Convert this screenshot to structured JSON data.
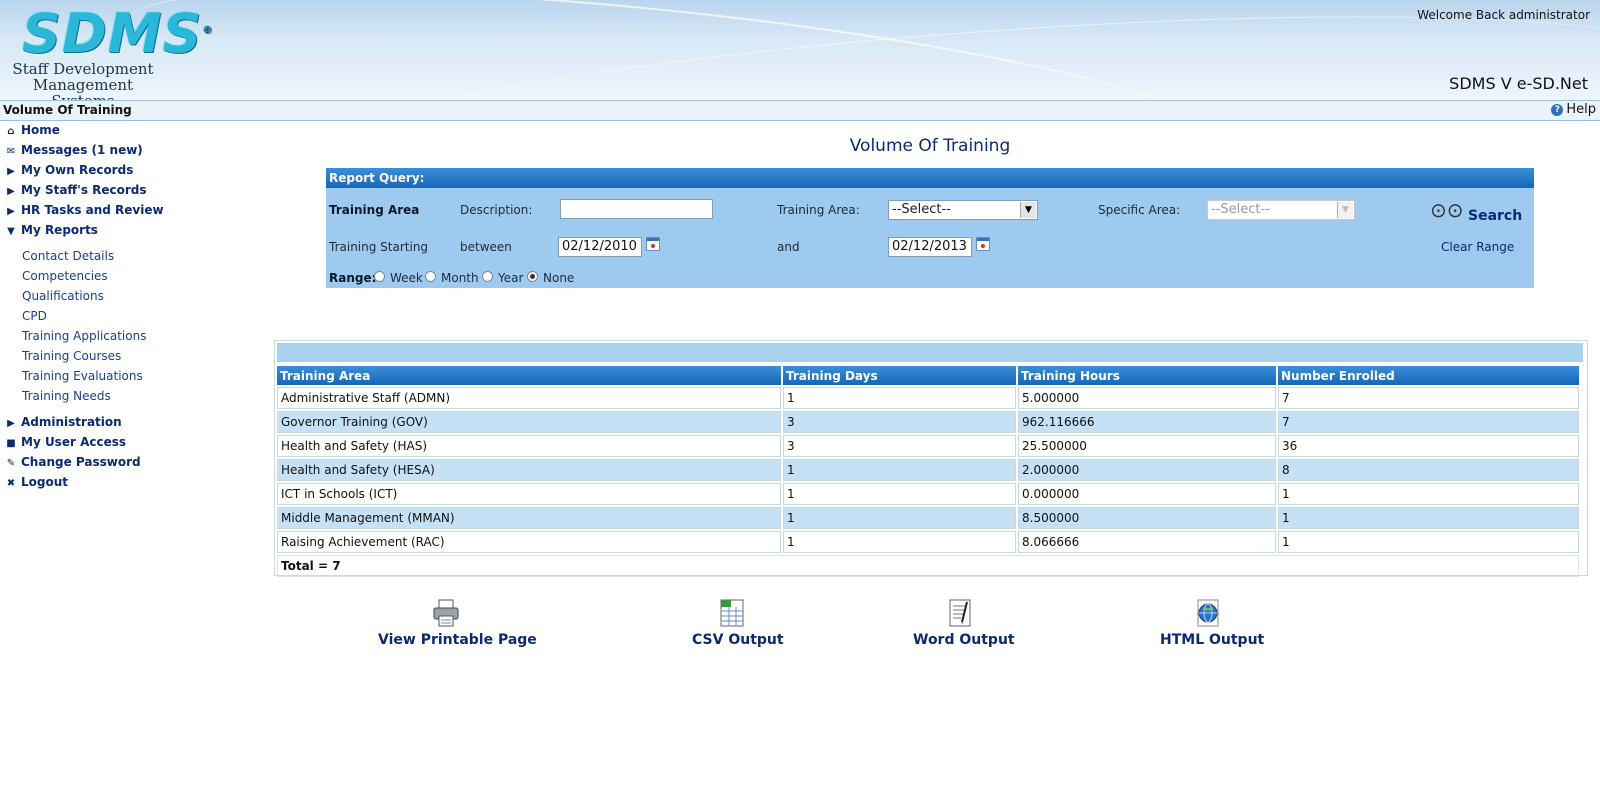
{
  "header": {
    "logo_text": "SDMS",
    "logo_subtitle_line1": "Staff Development",
    "logo_subtitle_line2": "Management Systems",
    "welcome": "Welcome Back administrator",
    "version": "SDMS V e-SD.Net"
  },
  "titlebar": {
    "title": "Volume Of Training",
    "help": "Help"
  },
  "sidebar": {
    "items": [
      {
        "label": "Home",
        "icon": "home-icon"
      },
      {
        "label": "Messages (1 new)",
        "icon": "envelope-icon"
      },
      {
        "label": "My Own Records",
        "icon": "triangle-right-icon"
      },
      {
        "label": "My Staff's Records",
        "icon": "triangle-right-icon"
      },
      {
        "label": "HR Tasks and Review",
        "icon": "triangle-right-icon"
      },
      {
        "label": "My Reports",
        "icon": "triangle-down-icon"
      }
    ],
    "subitems": [
      "Contact Details",
      "Competencies",
      "Qualifications",
      "CPD",
      "Training Applications",
      "Training Courses",
      "Training Evaluations",
      "Training Needs"
    ],
    "items_bottom": [
      {
        "label": "Administration",
        "icon": "triangle-right-icon"
      },
      {
        "label": "My User Access",
        "icon": "lock-icon"
      },
      {
        "label": "Change Password",
        "icon": "pen-icon"
      },
      {
        "label": "Logout",
        "icon": "x-icon"
      }
    ]
  },
  "main": {
    "page_title": "Volume Of Training",
    "query": {
      "header": "Report Query:",
      "training_area_label": "Training Area",
      "description_label": "Description:",
      "description_value": "",
      "area_label": "Training Area:",
      "area_value": "--Select--",
      "specific_label": "Specific Area:",
      "specific_value": "--Select--",
      "starting_label": "Training Starting",
      "between_label": "between",
      "from_date": "02/12/2010",
      "and_label": "and",
      "to_date": "02/12/2013",
      "range_label": "Range:",
      "range_options": [
        "Week",
        "Month",
        "Year",
        "None"
      ],
      "range_selected": "None",
      "search_label": "Search",
      "clear_label": "Clear Range"
    },
    "table": {
      "headers": [
        "Training Area",
        "Training Days",
        "Training Hours",
        "Number Enrolled"
      ],
      "rows": [
        [
          "Administrative Staff (ADMN)",
          "1",
          "5.000000",
          "7"
        ],
        [
          "Governor Training (GOV)",
          "3",
          "962.116666",
          "7"
        ],
        [
          "Health and Safety (HAS)",
          "3",
          "25.500000",
          "36"
        ],
        [
          "Health and Safety (HESA)",
          "1",
          "2.000000",
          "8"
        ],
        [
          "ICT in Schools (ICT)",
          "1",
          "0.000000",
          "1"
        ],
        [
          "Middle Management (MMAN)",
          "1",
          "8.500000",
          "1"
        ],
        [
          "Raising Achievement (RAC)",
          "1",
          "8.066666",
          "1"
        ]
      ],
      "total": "Total = 7"
    },
    "outputs": [
      {
        "label": "View Printable Page",
        "icon": "printer-icon"
      },
      {
        "label": "CSV Output",
        "icon": "spreadsheet-icon"
      },
      {
        "label": "Word Output",
        "icon": "document-icon"
      },
      {
        "label": "HTML Output",
        "icon": "globe-icon"
      }
    ]
  },
  "colors": {
    "accent": "#1566b8",
    "panel": "#9dcaee",
    "row_alt": "#c6e1f5",
    "link": "#0b2a6f"
  }
}
